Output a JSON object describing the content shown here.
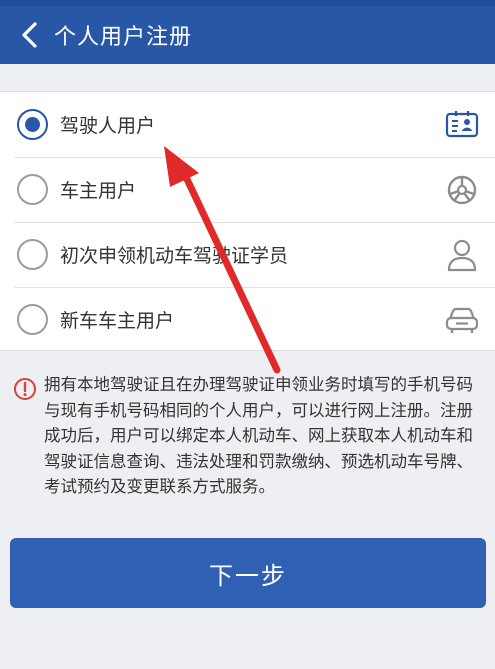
{
  "header": {
    "back_icon": "chevron-left-icon",
    "title": "个人用户注册"
  },
  "options": [
    {
      "label": "驾驶人用户",
      "selected": true,
      "icon": "id-card-icon"
    },
    {
      "label": "车主用户",
      "selected": false,
      "icon": "wheel-icon"
    },
    {
      "label": "初次申领机动车驾驶证学员",
      "selected": false,
      "icon": "person-icon"
    },
    {
      "label": "新车车主用户",
      "selected": false,
      "icon": "car-icon"
    }
  ],
  "notice": {
    "icon": "info-icon",
    "text": "拥有本地驾驶证且在办理驾驶证申领业务时填写的手机号码与现有手机号码相同的个人用户，可以进行网上注册。注册成功后，用户可以绑定本人机动车、网上获取本人机动车和驾驶证信息查询、违法处理和罚款缴纳、预选机动车号牌、考试预约及变更联系方式服务。"
  },
  "next_button": {
    "label": "下一步"
  },
  "colors": {
    "header": "#2757a6",
    "accent": "#2757a6",
    "button": "#2f60b3",
    "info_icon": "#d9413b",
    "annotation_arrow": "#e02a2a",
    "background": "#eeeff3"
  }
}
